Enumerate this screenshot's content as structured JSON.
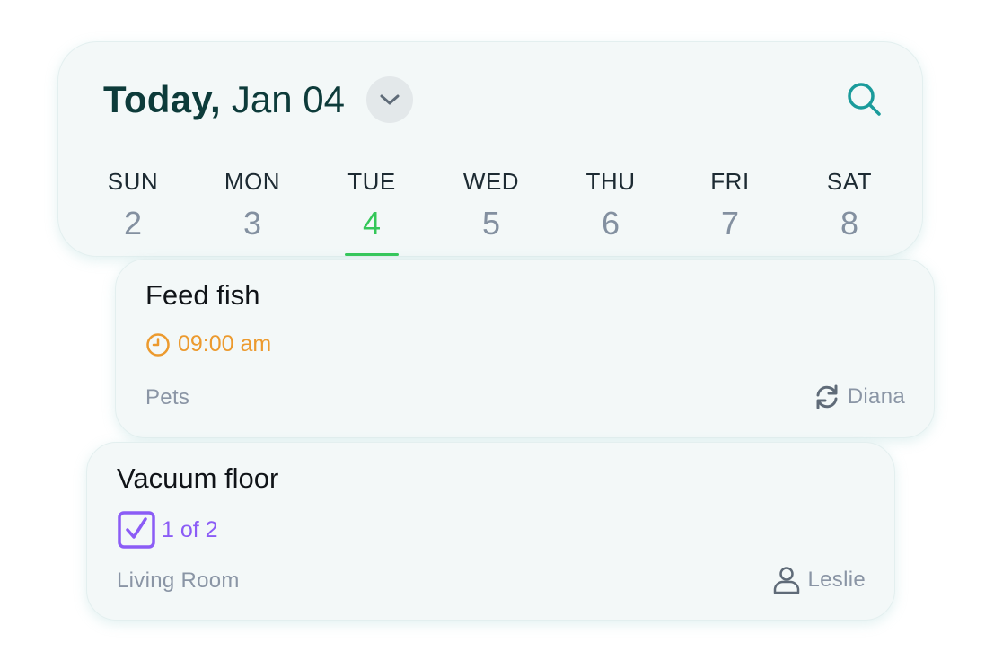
{
  "header": {
    "today_label": "Today,",
    "date_label": "Jan 04",
    "dropdown_icon": "chevron-down-icon",
    "search_icon": "search-icon"
  },
  "week": {
    "days": [
      {
        "name": "SUN",
        "number": "2"
      },
      {
        "name": "MON",
        "number": "3"
      },
      {
        "name": "TUE",
        "number": "4"
      },
      {
        "name": "WED",
        "number": "5"
      },
      {
        "name": "THU",
        "number": "6"
      },
      {
        "name": "FRI",
        "number": "7"
      },
      {
        "name": "SAT",
        "number": "8"
      }
    ],
    "selected_index": 2
  },
  "tasks": [
    {
      "title": "Feed fish",
      "meta_text": "09:00 am",
      "meta_icon": "clock-icon",
      "category": "Pets",
      "assignee": "Diana",
      "assignee_icon": "repeat-icon"
    },
    {
      "title": "Vacuum floor",
      "meta_text": "1 of 2",
      "meta_icon": "checkbox-checked-icon",
      "category": "Living Room",
      "assignee": "Leslie",
      "assignee_icon": "person-icon"
    }
  ],
  "colors": {
    "accent_green": "#34c759",
    "title_dark": "#0d3b3a",
    "search_teal": "#1a9b9b",
    "time_orange": "#ec9a2e",
    "checklist_purple": "#8b5cf6",
    "muted_gray": "#8a95a5",
    "card_bg": "#f3f8f8"
  }
}
